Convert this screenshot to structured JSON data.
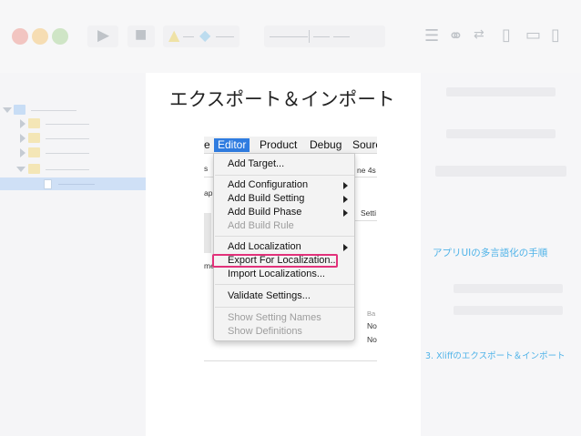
{
  "slide": {
    "title": "エクスポート＆インポート"
  },
  "inspector": {
    "link_1": "アプリUIの多言語化の手順",
    "link_2": "3. Xliffのエクスポート＆インポート"
  },
  "colors": {
    "accent_link": "#4fb3e8",
    "menu_highlight": "#2f7ce0",
    "annotation_box": "#e2317a"
  },
  "xcode": {
    "menubar": {
      "partial_left": "e",
      "editor": "Editor",
      "product": "Product",
      "debug": "Debug",
      "partial_right": "Sourc"
    },
    "background": {
      "s": "s",
      "ap": "ap",
      "me": "me",
      "ne4s": "ne 4s",
      "setti": "Setti",
      "ba": "Ba",
      "no1": "No",
      "no2": "No"
    },
    "menu": {
      "add_target": "Add Target...",
      "add_configuration": "Add Configuration",
      "add_build_setting": "Add Build Setting",
      "add_build_phase": "Add Build Phase",
      "add_build_rule": "Add Build Rule",
      "add_localization": "Add Localization",
      "export_for_localization": "Export For Localization...",
      "import_localizations": "Import Localizations...",
      "validate_settings": "Validate Settings...",
      "show_setting_names": "Show Setting Names",
      "show_definitions": "Show Definitions"
    }
  }
}
